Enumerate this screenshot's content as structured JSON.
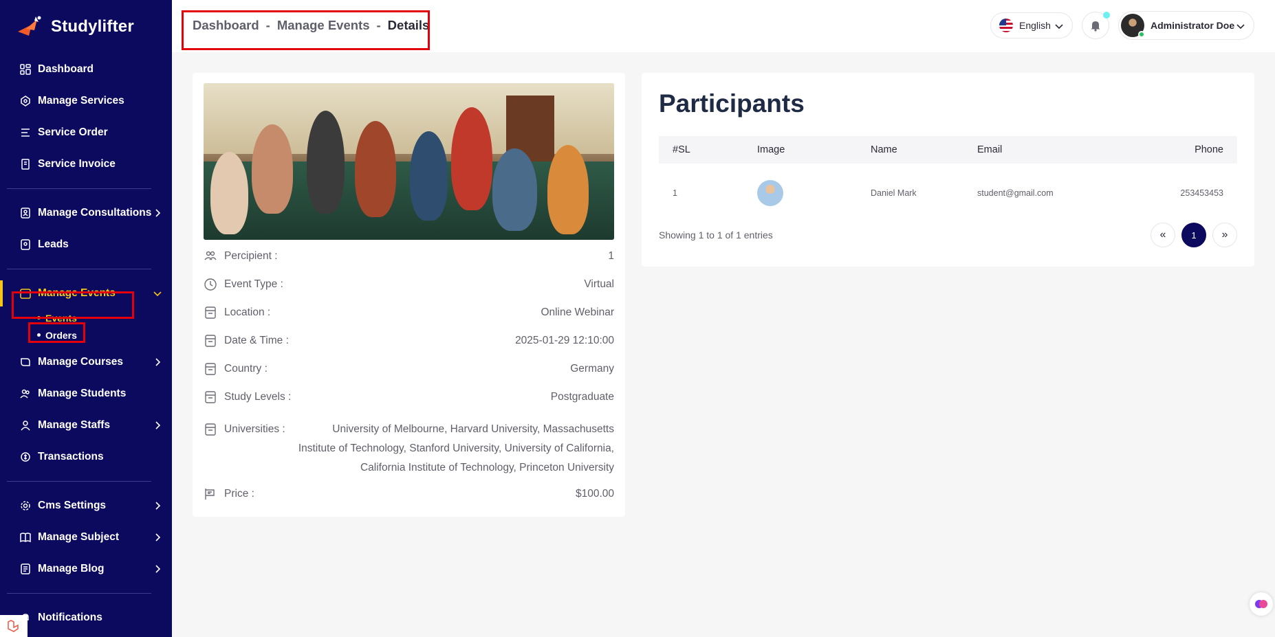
{
  "brand": {
    "name": "Studylifter"
  },
  "sidebar": {
    "items": [
      {
        "label": "Dashboard",
        "icon": "dashboard-icon"
      },
      {
        "label": "Manage Services",
        "icon": "services-icon"
      },
      {
        "label": "Service Order",
        "icon": "order-icon"
      },
      {
        "label": "Service Invoice",
        "icon": "invoice-icon"
      },
      {
        "label": "Manage Consultations",
        "icon": "consultation-icon"
      },
      {
        "label": "Leads",
        "icon": "leads-icon"
      },
      {
        "label": "Manage Events",
        "icon": "calendar-icon"
      },
      {
        "label": "Manage Courses",
        "icon": "courses-icon"
      },
      {
        "label": "Manage Students",
        "icon": "students-icon"
      },
      {
        "label": "Manage Staffs",
        "icon": "staff-icon"
      },
      {
        "label": "Transactions",
        "icon": "transactions-icon"
      },
      {
        "label": "Cms Settings",
        "icon": "settings-icon"
      },
      {
        "label": "Manage Subject",
        "icon": "book-icon"
      },
      {
        "label": "Manage Blog",
        "icon": "blog-icon"
      },
      {
        "label": "Notifications",
        "icon": "notification-icon"
      }
    ],
    "submenu": [
      {
        "label": "Events"
      },
      {
        "label": "Orders"
      }
    ]
  },
  "header": {
    "breadcrumb": [
      "Dashboard",
      "-",
      "Manage Events",
      "-",
      "Details"
    ],
    "language": "English",
    "user_name": "Administrator Doe"
  },
  "event": {
    "details": [
      {
        "label": "Percipient :",
        "value": "1",
        "icon": "group-icon"
      },
      {
        "label": "Event Type :",
        "value": "Virtual",
        "icon": "clock-icon"
      },
      {
        "label": "Location :",
        "value": "Online Webinar",
        "icon": "archive-icon"
      },
      {
        "label": "Date & Time :",
        "value": "2025-01-29 12:10:00",
        "icon": "archive-icon"
      },
      {
        "label": "Country :",
        "value": "Germany",
        "icon": "archive-icon"
      },
      {
        "label": "Study Levels :",
        "value": "Postgraduate",
        "icon": "archive-icon"
      },
      {
        "label": "Universities :",
        "value": "University of Melbourne, Harvard University, Massachusetts Institute of Technology, Stanford University, University of California, California Institute of Technology, Princeton University",
        "icon": "archive-icon"
      },
      {
        "label": "Price :",
        "value": "$100.00",
        "icon": "price-icon"
      }
    ]
  },
  "participants": {
    "title": "Participants",
    "columns": [
      "#SL",
      "Image",
      "Name",
      "Email",
      "Phone"
    ],
    "rows": [
      {
        "sl": "1",
        "name": "Daniel Mark",
        "email": "student@gmail.com",
        "phone": "253453453"
      }
    ],
    "info": "Showing 1 to 1 of 1 entries",
    "pager": {
      "prev": "«",
      "current": "1",
      "next": "»"
    }
  },
  "colors": {
    "sidebar": "#0c0a5f",
    "accent": "#f5c518",
    "highlight_box": "#e3000b"
  }
}
